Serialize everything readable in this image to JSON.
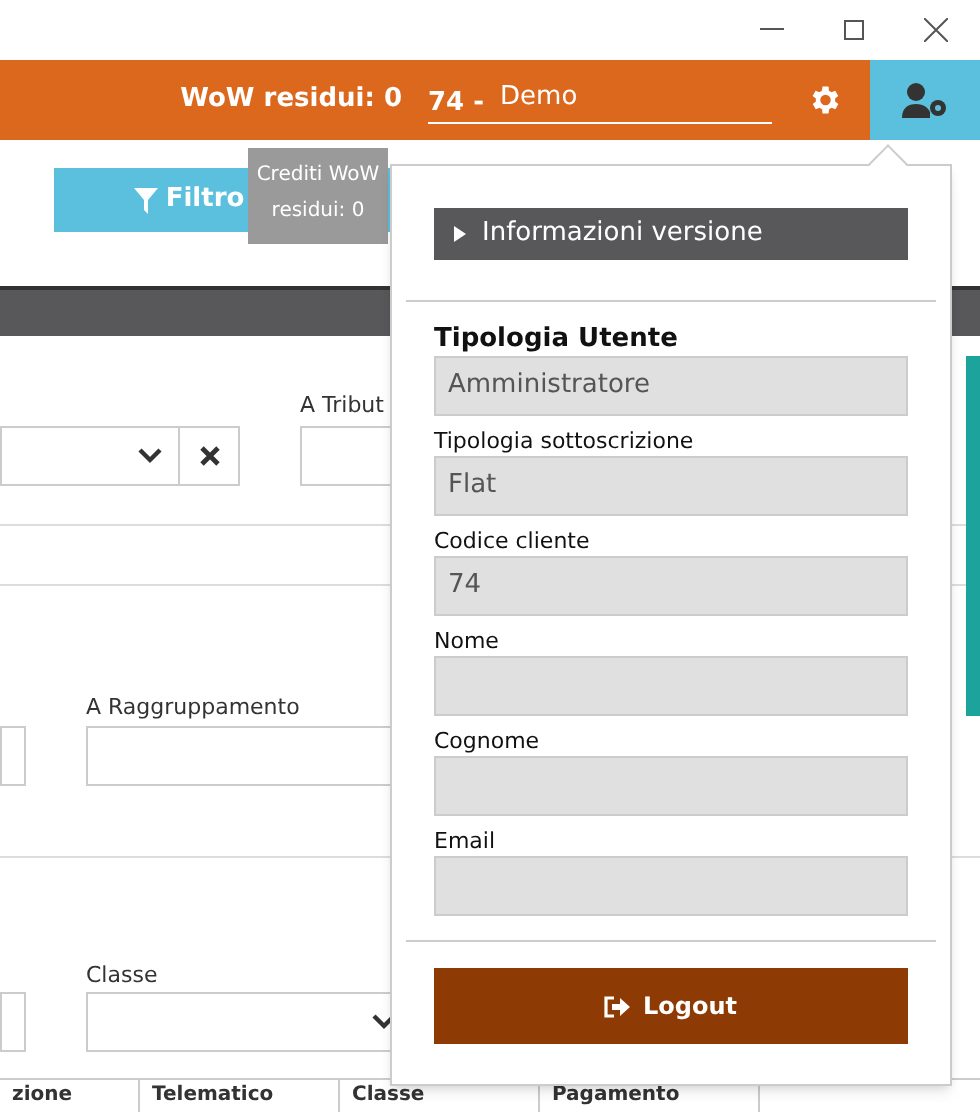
{
  "header": {
    "credits": "WoW residui: 0",
    "client_code": "74 -",
    "client_name": "Demo"
  },
  "toolbar": {
    "filter_button": "Filtro",
    "tooltip": "Crediti WoW residui: 0"
  },
  "form": {
    "tributo_label": "A Tribut",
    "raggruppamento_label": "A Raggruppamento",
    "classe_label": "Classe"
  },
  "table": {
    "columns": [
      "zione",
      "Telematico",
      "Classe",
      "Pagamento"
    ]
  },
  "user_menu": {
    "version_toggle": "Informazioni versione",
    "version_expanded": false,
    "title": "Tipologia Utente",
    "fields": [
      {
        "value": "Amministratore"
      },
      {
        "label": "Tipologia sottoscrizione",
        "value": "Flat"
      },
      {
        "label": "Codice cliente",
        "value": "74"
      },
      {
        "label": "Nome"
      },
      {
        "label": "Cognome"
      },
      {
        "label": "Email"
      }
    ],
    "logout_button": "Logout"
  }
}
